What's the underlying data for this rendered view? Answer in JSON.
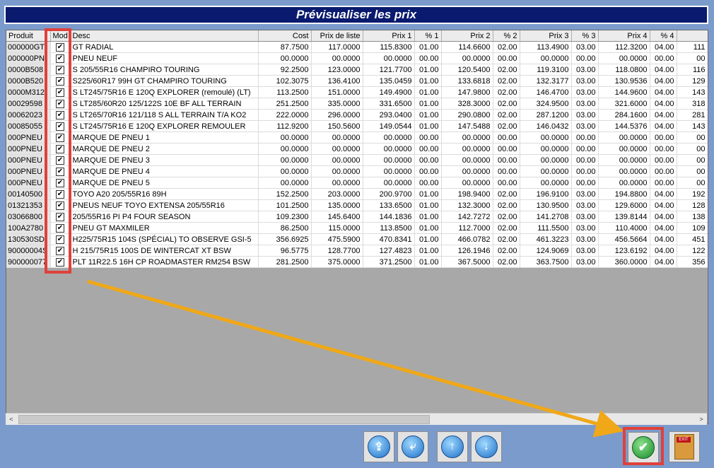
{
  "window": {
    "title": "Prévisualiser les prix"
  },
  "table": {
    "headers": [
      "Produit",
      "Mod",
      "Desc",
      "Cost",
      "Prix de liste",
      "Prix 1",
      "% 1",
      "Prix 2",
      "% 2",
      "Prix 3",
      "% 3",
      "Prix 4",
      "% 4",
      ""
    ],
    "rows": [
      [
        "000000GT",
        "✔",
        "GT RADIAL",
        "87.7500",
        "117.0000",
        "115.8300",
        "01.00",
        "114.6600",
        "02.00",
        "113.4900",
        "03.00",
        "112.3200",
        "04.00",
        "111"
      ],
      [
        "000000PN",
        "✔",
        "PNEU NEUF",
        "00.0000",
        "00.0000",
        "00.0000",
        "00.00",
        "00.0000",
        "00.00",
        "00.0000",
        "00.00",
        "00.0000",
        "00.00",
        "00"
      ],
      [
        "0000B508",
        "✔",
        "S 205/55R16 CHAMPIRO TOURING",
        "92.2500",
        "123.0000",
        "121.7700",
        "01.00",
        "120.5400",
        "02.00",
        "119.3100",
        "03.00",
        "118.0800",
        "04.00",
        "116"
      ],
      [
        "0000B520",
        "✔",
        "S225/60R17 99H GT CHAMPIRO TOURING",
        "102.3075",
        "136.4100",
        "135.0459",
        "01.00",
        "133.6818",
        "02.00",
        "132.3177",
        "03.00",
        "130.9536",
        "04.00",
        "129"
      ],
      [
        "0000M312",
        "✔",
        "S LT245/75R16 E 120Q EXPLORER (remoulé) (LT)",
        "113.2500",
        "151.0000",
        "149.4900",
        "01.00",
        "147.9800",
        "02.00",
        "146.4700",
        "03.00",
        "144.9600",
        "04.00",
        "143"
      ],
      [
        "00029598",
        "✔",
        "S LT285/60R20 125/122S 10E BF ALL TERRAIN",
        "251.2500",
        "335.0000",
        "331.6500",
        "01.00",
        "328.3000",
        "02.00",
        "324.9500",
        "03.00",
        "321.6000",
        "04.00",
        "318"
      ],
      [
        "00062023",
        "✔",
        "S LT265/70R16 121/118 S ALL TERRAIN T/A KO2",
        "222.0000",
        "296.0000",
        "293.0400",
        "01.00",
        "290.0800",
        "02.00",
        "287.1200",
        "03.00",
        "284.1600",
        "04.00",
        "281"
      ],
      [
        "00085055",
        "✔",
        "S LT245/75R16 E 120Q EXPLORER REMOULER",
        "112.9200",
        "150.5600",
        "149.0544",
        "01.00",
        "147.5488",
        "02.00",
        "146.0432",
        "03.00",
        "144.5376",
        "04.00",
        "143"
      ],
      [
        "000PNEU",
        "✔",
        "MARQUE DE PNEU 1",
        "00.0000",
        "00.0000",
        "00.0000",
        "00.00",
        "00.0000",
        "00.00",
        "00.0000",
        "00.00",
        "00.0000",
        "00.00",
        "00"
      ],
      [
        "000PNEU",
        "✔",
        "MARQUE DE PNEU 2",
        "00.0000",
        "00.0000",
        "00.0000",
        "00.00",
        "00.0000",
        "00.00",
        "00.0000",
        "00.00",
        "00.0000",
        "00.00",
        "00"
      ],
      [
        "000PNEU",
        "✔",
        "MARQUE DE PNEU 3",
        "00.0000",
        "00.0000",
        "00.0000",
        "00.00",
        "00.0000",
        "00.00",
        "00.0000",
        "00.00",
        "00.0000",
        "00.00",
        "00"
      ],
      [
        "000PNEU",
        "✔",
        "MARQUE DE PNEU 4",
        "00.0000",
        "00.0000",
        "00.0000",
        "00.00",
        "00.0000",
        "00.00",
        "00.0000",
        "00.00",
        "00.0000",
        "00.00",
        "00"
      ],
      [
        "000PNEU",
        "✔",
        "MARQUE DE PNEU 5",
        "00.0000",
        "00.0000",
        "00.0000",
        "00.00",
        "00.0000",
        "00.00",
        "00.0000",
        "00.00",
        "00.0000",
        "00.00",
        "00"
      ],
      [
        "00140500",
        "✔",
        "TOYO A20 205/55R16 89H",
        "152.2500",
        "203.0000",
        "200.9700",
        "01.00",
        "198.9400",
        "02.00",
        "196.9100",
        "03.00",
        "194.8800",
        "04.00",
        "192"
      ],
      [
        "01321353",
        "✔",
        "PNEUS NEUF TOYO EXTENSA 205/55R16",
        "101.2500",
        "135.0000",
        "133.6500",
        "01.00",
        "132.3000",
        "02.00",
        "130.9500",
        "03.00",
        "129.6000",
        "04.00",
        "128"
      ],
      [
        "03066800",
        "✔",
        "205/55R16 PI P4 FOUR SEASON",
        "109.2300",
        "145.6400",
        "144.1836",
        "01.00",
        "142.7272",
        "02.00",
        "141.2708",
        "03.00",
        "139.8144",
        "04.00",
        "138"
      ],
      [
        "100A2780",
        "✔",
        "PNEU GT MAXMILER",
        "86.2500",
        "115.0000",
        "113.8500",
        "01.00",
        "112.7000",
        "02.00",
        "111.5500",
        "03.00",
        "110.4000",
        "04.00",
        "109"
      ],
      [
        "130530SD",
        "✔",
        "H225/75R15 104S (SPÉCIAL) TO OBSERVE GSI-5",
        "356.6925",
        "475.5900",
        "470.8341",
        "01.00",
        "466.0782",
        "02.00",
        "461.3223",
        "03.00",
        "456.5664",
        "04.00",
        "451"
      ],
      [
        "90000004S",
        "✔",
        "H 215/75R15 100S DE WINTERCAT XT BSW",
        "96.5775",
        "128.7700",
        "127.4823",
        "01.00",
        "126.1946",
        "02.00",
        "124.9069",
        "03.00",
        "123.6192",
        "04.00",
        "122"
      ],
      [
        "900000077",
        "✔",
        "PLT 11R22.5 16H CP ROADMASTER RM254 BSW",
        "281.2500",
        "375.0000",
        "371.2500",
        "01.00",
        "367.5000",
        "02.00",
        "363.7500",
        "03.00",
        "360.0000",
        "04.00",
        "356"
      ]
    ]
  },
  "scrollbar": {
    "left_arrow": "<",
    "right_arrow": ">"
  },
  "toolbar": {
    "buttons": [
      {
        "name": "import-button",
        "icon": "import-icon",
        "glyph": "⇪"
      },
      {
        "name": "export-button",
        "icon": "export-icon",
        "glyph": "⤶"
      },
      {
        "name": "move-up-button",
        "icon": "arrow-up-icon",
        "glyph": "↑"
      },
      {
        "name": "move-down-button",
        "icon": "arrow-down-icon",
        "glyph": "↓"
      },
      {
        "name": "confirm-button",
        "icon": "checkmark-icon",
        "glyph": "✔"
      },
      {
        "name": "exit-button",
        "icon": "exit-door-icon",
        "glyph": "EXIT"
      }
    ]
  },
  "colors": {
    "title_bg": "#0a1a6e",
    "window_bg": "#7b9bcc",
    "highlight": "#e0403a",
    "arrow": "#f0a818"
  }
}
